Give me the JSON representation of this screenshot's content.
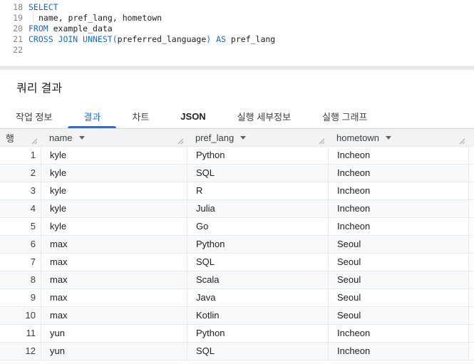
{
  "editor": {
    "lines": [
      {
        "num": "18",
        "tokens": [
          {
            "t": "SELECT",
            "c": "kw"
          }
        ]
      },
      {
        "num": "19",
        "tokens": [
          {
            "t": "",
            "c": "ind"
          },
          {
            "t": "name, pref_lang, hometown",
            "c": "pl"
          }
        ]
      },
      {
        "num": "20",
        "tokens": [
          {
            "t": "FROM",
            "c": "kw"
          },
          {
            "t": " example_data",
            "c": "pl"
          }
        ]
      },
      {
        "num": "21",
        "tokens": [
          {
            "t": "CROSS JOIN UNNEST",
            "c": "kw"
          },
          {
            "t": "(",
            "c": "kw"
          },
          {
            "t": "preferred_language",
            "c": "pl"
          },
          {
            "t": ")",
            "c": "kw"
          },
          {
            "t": " ",
            "c": "pl"
          },
          {
            "t": "AS",
            "c": "kw"
          },
          {
            "t": " pref_lang",
            "c": "pl"
          }
        ]
      },
      {
        "num": "22",
        "tokens": []
      }
    ]
  },
  "results_panel": {
    "title": "쿼리 결과"
  },
  "tabs": [
    {
      "label": "작업 정보",
      "active": false,
      "bold": false
    },
    {
      "label": "결과",
      "active": true,
      "bold": false
    },
    {
      "label": "차트",
      "active": false,
      "bold": false
    },
    {
      "label": "JSON",
      "active": false,
      "bold": true
    },
    {
      "label": "실행 세부정보",
      "active": false,
      "bold": false
    },
    {
      "label": "실행 그래프",
      "active": false,
      "bold": false
    }
  ],
  "table": {
    "row_header": "행",
    "columns": [
      {
        "label": "name"
      },
      {
        "label": "pref_lang"
      },
      {
        "label": "hometown"
      }
    ],
    "rows": [
      {
        "n": "1",
        "name": "kyle",
        "pref_lang": "Python",
        "hometown": "Incheon"
      },
      {
        "n": "2",
        "name": "kyle",
        "pref_lang": "SQL",
        "hometown": "Incheon"
      },
      {
        "n": "3",
        "name": "kyle",
        "pref_lang": "R",
        "hometown": "Incheon"
      },
      {
        "n": "4",
        "name": "kyle",
        "pref_lang": "Julia",
        "hometown": "Incheon"
      },
      {
        "n": "5",
        "name": "kyle",
        "pref_lang": "Go",
        "hometown": "Incheon"
      },
      {
        "n": "6",
        "name": "max",
        "pref_lang": "Python",
        "hometown": "Seoul"
      },
      {
        "n": "7",
        "name": "max",
        "pref_lang": "SQL",
        "hometown": "Seoul"
      },
      {
        "n": "8",
        "name": "max",
        "pref_lang": "Scala",
        "hometown": "Seoul"
      },
      {
        "n": "9",
        "name": "max",
        "pref_lang": "Java",
        "hometown": "Seoul"
      },
      {
        "n": "10",
        "name": "max",
        "pref_lang": "Kotlin",
        "hometown": "Seoul"
      },
      {
        "n": "11",
        "name": "yun",
        "pref_lang": "Python",
        "hometown": "Incheon"
      },
      {
        "n": "12",
        "name": "yun",
        "pref_lang": "SQL",
        "hometown": "Incheon"
      }
    ]
  },
  "colors": {
    "keyword_blue": "#1967d2",
    "active_tab_blue": "#1a73e8",
    "table_header_bg": "#f1f3f4",
    "zebra_row_bg": "#f8f9fa",
    "border_gray": "#e8eaed",
    "splitter_gray": "#e8e8e8"
  }
}
